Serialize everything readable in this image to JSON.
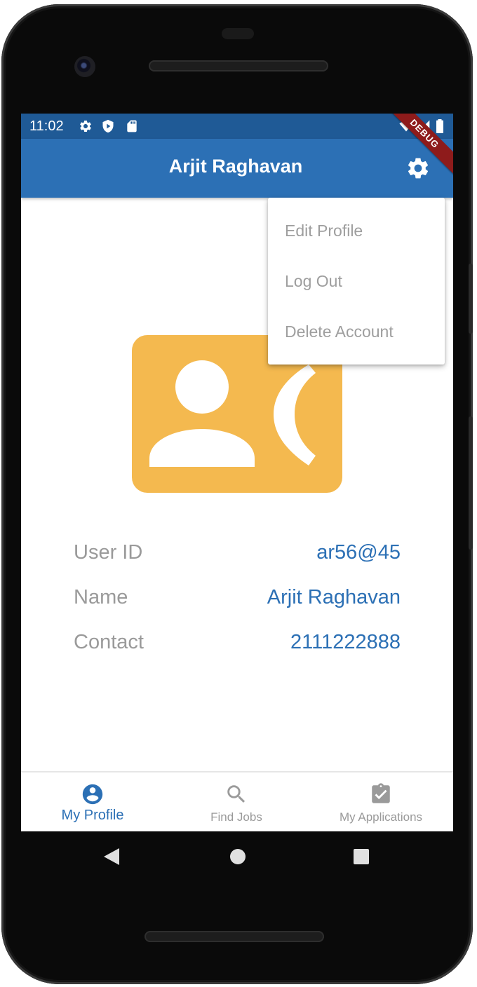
{
  "status_bar": {
    "time": "11:02",
    "left_icons": [
      "gear-icon",
      "shield-play-icon",
      "sd-card-icon"
    ],
    "right_icons": [
      "wifi-icon",
      "signal-icon",
      "battery-icon"
    ]
  },
  "app_bar": {
    "title": "Arjit Raghavan",
    "action_icon": "settings-gear-icon"
  },
  "debug_banner": "DEBUG",
  "menu": {
    "items": [
      {
        "label": "Edit Profile"
      },
      {
        "label": "Log Out"
      },
      {
        "label": "Delete Account"
      }
    ]
  },
  "profile": {
    "avatar_icon": "contact-phone-icon",
    "fields": [
      {
        "label": "User ID",
        "value": "ar56@45"
      },
      {
        "label": "Name",
        "value": "Arjit Raghavan"
      },
      {
        "label": "Contact",
        "value": "2111222888"
      }
    ]
  },
  "bottom_nav": {
    "items": [
      {
        "label": "My Profile",
        "icon": "account-circle-icon",
        "active": true
      },
      {
        "label": "Find Jobs",
        "icon": "search-icon",
        "active": false
      },
      {
        "label": "My Applications",
        "icon": "assignment-check-icon",
        "active": false
      }
    ]
  },
  "system_nav": [
    "back-icon",
    "home-icon",
    "recents-icon"
  ],
  "colors": {
    "primary": "#2c70b5",
    "status_bar": "#1f5a96",
    "avatar": "#f4b94f",
    "muted_text": "#9a9a9a",
    "debug": "#8e1b1b"
  }
}
